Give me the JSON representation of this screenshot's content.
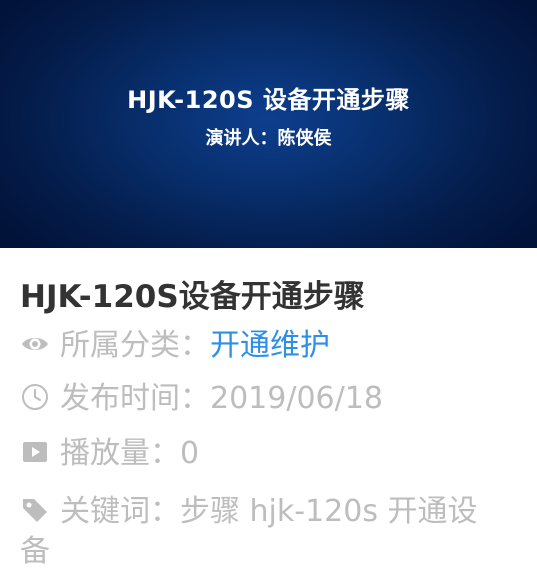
{
  "banner": {
    "title": "HJK-120S 设备开通步骤",
    "speaker": "演讲人：陈侠侯"
  },
  "video": {
    "title": "HJK-120S设备开通步骤",
    "category_label": "所属分类：",
    "category_value": "开通维护",
    "date_label": "发布时间：",
    "date_value": "2019/06/18",
    "plays_label": "播放量：",
    "plays_value": "0",
    "keywords_label": "关键词：",
    "keywords_value": "步骤 hjk-120s 开通设备"
  },
  "icons": {
    "category": "eye-icon",
    "date": "clock-icon",
    "plays": "play-icon",
    "keywords": "tag-icon"
  },
  "colors": {
    "banner_bg": "#05245a",
    "title_text": "#333333",
    "meta_text": "#bdbdbd",
    "link": "#2f8fe6"
  }
}
